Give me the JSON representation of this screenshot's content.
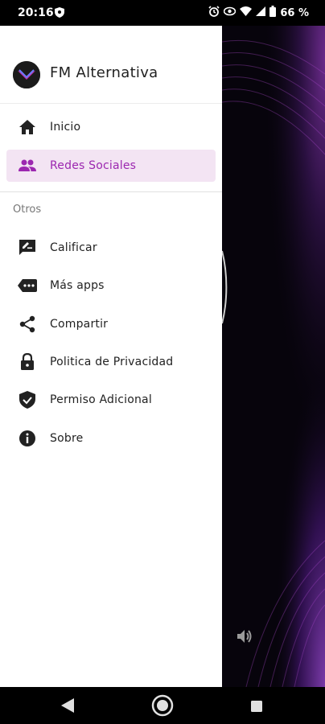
{
  "status_bar": {
    "time": "20:16",
    "battery_percent": "66 %",
    "icons": [
      "shield-icon",
      "alarm-icon",
      "eye-icon",
      "wifi-icon",
      "signal-icon",
      "battery-icon"
    ]
  },
  "drawer": {
    "app_name": "FM Alternativa",
    "main_items": [
      {
        "label": "Inicio",
        "icon": "home-icon",
        "selected": false
      },
      {
        "label": "Redes Sociales",
        "icon": "people-icon",
        "selected": true
      }
    ],
    "section_label": "Otros",
    "other_items": [
      {
        "label": "Calificar",
        "icon": "rate-review-icon"
      },
      {
        "label": "Más apps",
        "icon": "more-apps-icon"
      },
      {
        "label": "Compartir",
        "icon": "share-icon"
      },
      {
        "label": "Politica de Privacidad",
        "icon": "lock-icon"
      },
      {
        "label": "Permiso Adicional",
        "icon": "verified-shield-icon"
      },
      {
        "label": "Sobre",
        "icon": "info-icon"
      }
    ]
  },
  "colors": {
    "accent": "#9c27b0",
    "selected_bg": "#f3e4f3",
    "background_app": "#07040c"
  },
  "nav_bar": {
    "icons": [
      "back-icon",
      "home-circle-icon",
      "recents-icon"
    ]
  }
}
